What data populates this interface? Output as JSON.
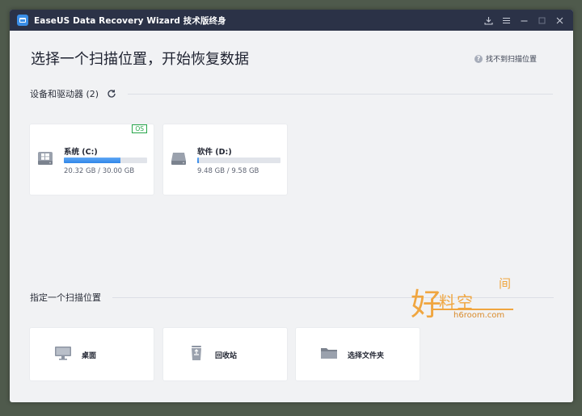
{
  "window": {
    "title": "EaseUS Data Recovery Wizard 技术版终身",
    "controls": [
      "download-icon",
      "menu-icon",
      "minimize-icon",
      "maximize-icon",
      "close-icon"
    ]
  },
  "page": {
    "title": "选择一个扫描位置，开始恢复数据",
    "help_link": "找不到扫描位置"
  },
  "devices": {
    "heading": "设备和驱动器 (2)",
    "drives": [
      {
        "name": "系统 (C:)",
        "size": "20.32 GB / 30.00 GB",
        "used_fraction": 0.677,
        "badge": "OS",
        "icon": "windows-drive-icon"
      },
      {
        "name": "软件 (D:)",
        "size": "9.48 GB / 9.58 GB",
        "used_fraction": 0.02,
        "icon": "hard-drive-icon"
      }
    ]
  },
  "locations": {
    "heading": "指定一个扫描位置",
    "items": [
      {
        "label": "桌面",
        "icon": "desktop-icon"
      },
      {
        "label": "回收站",
        "icon": "recycle-bin-icon"
      },
      {
        "label": "选择文件夹",
        "icon": "folder-icon"
      }
    ]
  },
  "watermark": {
    "main": "好",
    "chars": "料空",
    "top": "间",
    "url": "h6room.com"
  },
  "colors": {
    "titlebar": "#2b3247",
    "accent": "#2f86e8",
    "os_badge": "#27a64a",
    "watermark": "#f0a640"
  }
}
